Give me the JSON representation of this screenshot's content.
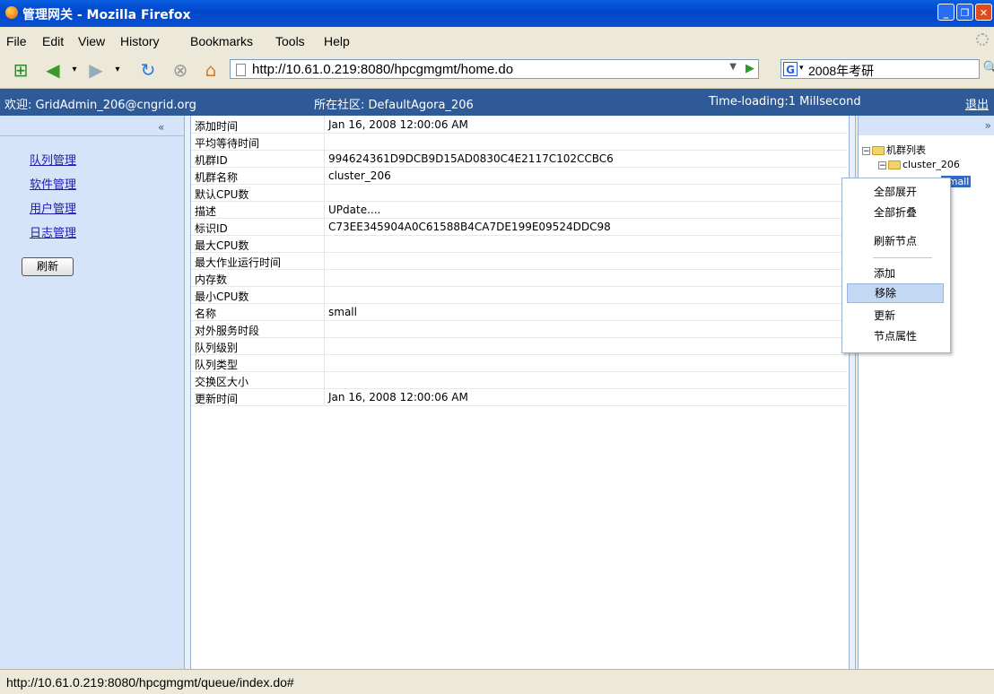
{
  "window": {
    "title": "管理网关 - Mozilla Firefox"
  },
  "menu": [
    "File",
    "Edit",
    "View",
    "History",
    "Bookmarks",
    "Tools",
    "Help"
  ],
  "address": {
    "url": "http://10.61.0.219:8080/hpcgmgmt/home.do"
  },
  "search": {
    "engine": "G",
    "value": "2008年考研"
  },
  "app_header": {
    "welcome": "欢迎: GridAdmin_206@cngrid.org",
    "community": "所在社区: DefaultAgora_206",
    "time_loading": "Time-loading:1 Millsecond",
    "logout": "退出"
  },
  "left_panel": {
    "collapse_glyph": "«",
    "links": [
      "队列管理",
      "软件管理",
      "用户管理",
      "日志管理"
    ],
    "refresh_button": "刷新"
  },
  "properties": [
    {
      "key": "添加时间",
      "value": "Jan 16, 2008 12:00:06 AM"
    },
    {
      "key": "平均等待时间",
      "value": ""
    },
    {
      "key": "机群ID",
      "value": "994624361D9DCB9D15AD0830C4E2117C102CCBC6"
    },
    {
      "key": "机群名称",
      "value": "cluster_206"
    },
    {
      "key": "默认CPU数",
      "value": ""
    },
    {
      "key": "描述",
      "value": "UPdate...."
    },
    {
      "key": "标识ID",
      "value": "C73EE345904A0C61588B4CA7DE199E09524DDC98"
    },
    {
      "key": "最大CPU数",
      "value": ""
    },
    {
      "key": "最大作业运行时间",
      "value": ""
    },
    {
      "key": "内存数",
      "value": ""
    },
    {
      "key": "最小CPU数",
      "value": ""
    },
    {
      "key": "名称",
      "value": "small"
    },
    {
      "key": "对外服务时段",
      "value": ""
    },
    {
      "key": "队列级别",
      "value": ""
    },
    {
      "key": "队列类型",
      "value": ""
    },
    {
      "key": "交换区大小",
      "value": ""
    },
    {
      "key": "更新时间",
      "value": "Jan 16, 2008 12:00:06 AM"
    }
  ],
  "tree": {
    "expand_glyph": "»",
    "root": "机群列表",
    "child": "cluster_206",
    "selected_leaf": "small"
  },
  "context_menu": {
    "items": [
      "全部展开",
      "全部折叠",
      "刷新节点",
      "添加",
      "移除",
      "更新",
      "节点属性"
    ],
    "highlighted": "移除"
  },
  "status_bar": {
    "text": "http://10.61.0.219:8080/hpcgmgmt/queue/index.do#"
  }
}
